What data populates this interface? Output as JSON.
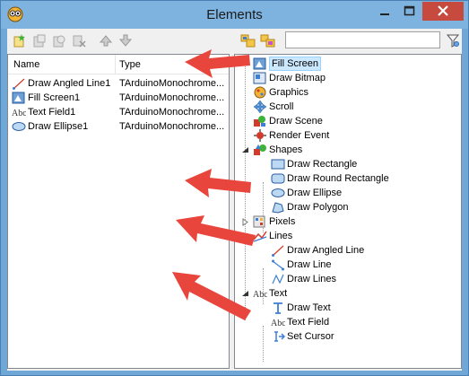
{
  "window": {
    "title": "Elements",
    "accent": "#7db3de",
    "close_color": "#c74a3f"
  },
  "toolbar_left": {
    "buttons": [
      "new-icon",
      "new-disabled-icon",
      "shield-icon",
      "delete-icon",
      "up-arrow-icon",
      "down-arrow-icon"
    ]
  },
  "toolbar_right": {
    "buttons": [
      "expand-all-icon",
      "collapse-all-icon"
    ],
    "filter_value": "",
    "filter_icon": "filter-icon"
  },
  "list": {
    "columns": [
      "Name",
      "Type"
    ],
    "rows": [
      {
        "name": "Draw Angled Line1",
        "type": "TArduinoMonochrome...",
        "icon": "angled-line-icon"
      },
      {
        "name": "Fill Screen1",
        "type": "TArduinoMonochrome...",
        "icon": "fill-screen-icon"
      },
      {
        "name": "Text Field1",
        "type": "TArduinoMonochrome...",
        "icon": "text-field-icon"
      },
      {
        "name": "Draw Ellipse1",
        "type": "TArduinoMonochrome...",
        "icon": "ellipse-icon"
      }
    ]
  },
  "tree": {
    "items": [
      {
        "label": "Fill Screen",
        "icon": "fill-screen-icon",
        "level": 0,
        "selected": true
      },
      {
        "label": "Draw Bitmap",
        "icon": "bitmap-icon",
        "level": 0
      },
      {
        "label": "Graphics",
        "icon": "graphics-icon",
        "level": 0
      },
      {
        "label": "Scroll",
        "icon": "scroll-icon",
        "level": 0
      },
      {
        "label": "Draw Scene",
        "icon": "scene-icon",
        "level": 0
      },
      {
        "label": "Render Event",
        "icon": "render-event-icon",
        "level": 0
      },
      {
        "label": "Shapes",
        "icon": "shapes-icon",
        "level": 0,
        "expanded": true
      },
      {
        "label": "Draw Rectangle",
        "icon": "rectangle-icon",
        "level": 1
      },
      {
        "label": "Draw Round Rectangle",
        "icon": "round-rectangle-icon",
        "level": 1
      },
      {
        "label": "Draw Ellipse",
        "icon": "ellipse-icon",
        "level": 1
      },
      {
        "label": "Draw Polygon",
        "icon": "polygon-icon",
        "level": 1
      },
      {
        "label": "Pixels",
        "icon": "pixels-icon",
        "level": 0,
        "expanded": false
      },
      {
        "label": "Lines",
        "icon": "lines-icon",
        "level": 0,
        "expanded": true
      },
      {
        "label": "Draw Angled Line",
        "icon": "angled-line-icon",
        "level": 1
      },
      {
        "label": "Draw Line",
        "icon": "line-icon",
        "level": 1
      },
      {
        "label": "Draw Lines",
        "icon": "multi-line-icon",
        "level": 1
      },
      {
        "label": "Text",
        "icon": "text-icon",
        "level": 0,
        "expanded": true
      },
      {
        "label": "Draw Text",
        "icon": "draw-text-icon",
        "level": 1
      },
      {
        "label": "Text Field",
        "icon": "text-field-icon",
        "level": 1
      },
      {
        "label": "Set Cursor",
        "icon": "cursor-icon",
        "level": 1
      }
    ]
  },
  "annotation_color": "#e8453c"
}
